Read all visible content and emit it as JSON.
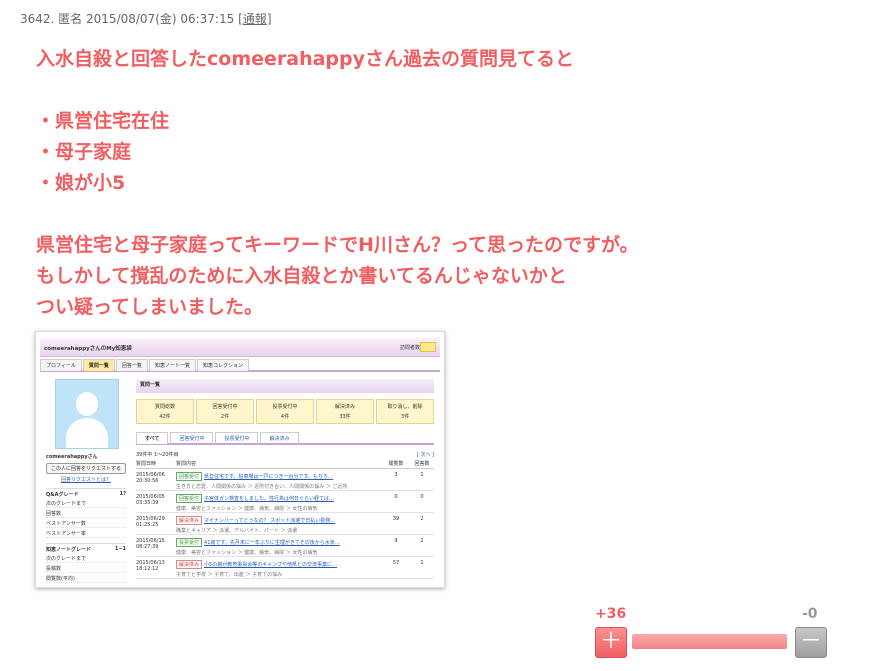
{
  "post": {
    "number": "3642.",
    "author": "匿名",
    "timestamp": "2015/08/07(金) 06:37:15",
    "report_open": "[",
    "report_label": "通報",
    "report_close": "]",
    "lines": [
      "入水自殺と回答したcomeerahappyさん過去の質問見てると",
      "",
      "・県営住宅在住",
      "・母子家庭",
      "・娘が小5",
      "",
      "県営住宅と母子家庭ってキーワードでH川さん？って思ったのですが。",
      "もしかして撹乱のために入水自殺とか書いてるんじゃないかと",
      "つい疑ってしまいました。"
    ]
  },
  "screenshot": {
    "title": "comeerahappyさんのMy知恵袋",
    "visits_label": "訪問者数",
    "tabs": [
      "プロフィール",
      "質問一覧",
      "回答一覧",
      "知恵ノート一覧",
      "知恵コレクション"
    ],
    "username": "comeerahappyさん",
    "request_button": "この人に回答をリクエストする",
    "request_link": "回答リクエストとは？",
    "qa_grade_label": "Q&Aグレード",
    "qa_grade_value": "1?",
    "qa_rows": [
      "次のグレードまで",
      "回答数",
      "ベストアンサー数",
      "ベストアンサー率"
    ],
    "note_grade_label": "知恵ノートグレード",
    "note_grade_value": "1−1",
    "note_rows": [
      "次のグレードまで",
      "投稿数",
      "閲覧数(平均)"
    ],
    "main_heading": "質問一覧",
    "stats": [
      {
        "label": "質問総数",
        "value": "42件"
      },
      {
        "label": "回答受付中",
        "value": "2件"
      },
      {
        "label": "投票受付中",
        "value": "4件"
      },
      {
        "label": "解決済み",
        "value": "33件"
      },
      {
        "label": "取り消し、削除",
        "value": "3件"
      }
    ],
    "question_tabs": [
      "すべて",
      "回答受付中",
      "投票受付中",
      "解決済み"
    ],
    "range_text": "39件中 1〜20件目",
    "next_link": "[ 次へ ]",
    "columns": {
      "date": "質問日時",
      "content": "質問内容",
      "views": "閲覧数",
      "answers": "回答数"
    },
    "questions": [
      {
        "date": "2015/06/06",
        "time": "20:30:56",
        "status": "回答受付",
        "title": "県営住宅です。駐車場は一戸につき一台分です。もちろ…",
        "category": "生き方と恋愛、人間関係の悩み ＞ 近所付き合い、人間関係の悩み ＞ ご近所",
        "views": "3",
        "answers": "1"
      },
      {
        "date": "2015/06/05",
        "time": "03:35:39",
        "status": "回答受付",
        "title": "子宮体ガン検査をしました。性行為は何日ぐらい経てば…",
        "category": "健康、美容とファッション ＞ 健康、病気、病院 ＞ 女性の病気",
        "views": "0",
        "answers": "0"
      },
      {
        "date": "2015/06/29",
        "time": "01:25:25",
        "status": "解決済み",
        "title": "マイナンバーってどうなの？ スポット派遣で日払い勤務…",
        "category": "職業とキャリア ＞ 派遣、アルバイト、パート ＞ 派遣",
        "views": "39",
        "answers": "2"
      },
      {
        "date": "2015/06/15",
        "time": "08:27:39",
        "status": "投票受付",
        "title": "41歳です。先月末に一年ぶりに生理がきてその後から水状…",
        "category": "健康、美容とファッション ＞ 健康、病気、病院 ＞ 女性の病気",
        "views": "9",
        "answers": "2"
      },
      {
        "date": "2015/06/13",
        "time": "18:12:12",
        "status": "解決済み",
        "title": "小5の娘が教育委員会等のキャンプや他県との交流事業に…",
        "category": "子育てと学校 ＞ 子育て、出産 ＞ 子育ての悩み",
        "views": "57",
        "answers": "1"
      }
    ]
  },
  "votes": {
    "plus_count": "+36",
    "minus_count": "-0",
    "plus_icon": "＋",
    "minus_icon": "－",
    "plus_ratio": 1.0,
    "colors": {
      "plus": "#ef5f62",
      "minus": "#9e9e9e"
    }
  }
}
